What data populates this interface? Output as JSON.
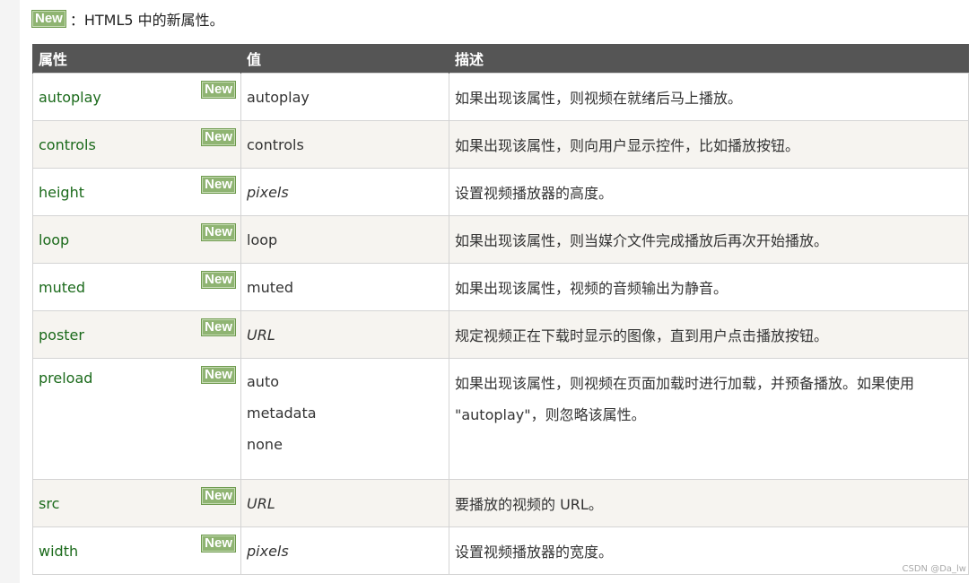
{
  "legend": {
    "badge": "New",
    "text": "：HTML5 中的新属性。"
  },
  "table": {
    "headers": [
      "属性",
      "值",
      "描述"
    ],
    "rows": [
      {
        "attr": "autoplay",
        "badge": "New",
        "values": [
          "autoplay"
        ],
        "italic": false,
        "desc": "如果出现该属性，则视频在就绪后马上播放。"
      },
      {
        "attr": "controls",
        "badge": "New",
        "values": [
          "controls"
        ],
        "italic": false,
        "desc": "如果出现该属性，则向用户显示控件，比如播放按钮。"
      },
      {
        "attr": "height",
        "badge": "New",
        "values": [
          "pixels"
        ],
        "italic": true,
        "desc": "设置视频播放器的高度。"
      },
      {
        "attr": "loop",
        "badge": "New",
        "values": [
          "loop"
        ],
        "italic": false,
        "desc": "如果出现该属性，则当媒介文件完成播放后再次开始播放。"
      },
      {
        "attr": "muted",
        "badge": "New",
        "values": [
          "muted"
        ],
        "italic": false,
        "desc": "如果出现该属性，视频的音频输出为静音。"
      },
      {
        "attr": "poster",
        "badge": "New",
        "values": [
          "URL"
        ],
        "italic": true,
        "desc": "规定视频正在下载时显示的图像，直到用户点击播放按钮。"
      },
      {
        "attr": "preload",
        "badge": "New",
        "values": [
          "auto",
          "metadata",
          "none"
        ],
        "italic": false,
        "desc": "如果出现该属性，则视频在页面加载时进行加载，并预备播放。如果使用 \"autoplay\"，则忽略该属性。"
      },
      {
        "attr": "src",
        "badge": "New",
        "values": [
          "URL"
        ],
        "italic": true,
        "desc": "要播放的视频的 URL。"
      },
      {
        "attr": "width",
        "badge": "New",
        "values": [
          "pixels"
        ],
        "italic": true,
        "desc": "设置视频播放器的宽度。"
      }
    ]
  },
  "watermark": "CSDN @Da_lw"
}
